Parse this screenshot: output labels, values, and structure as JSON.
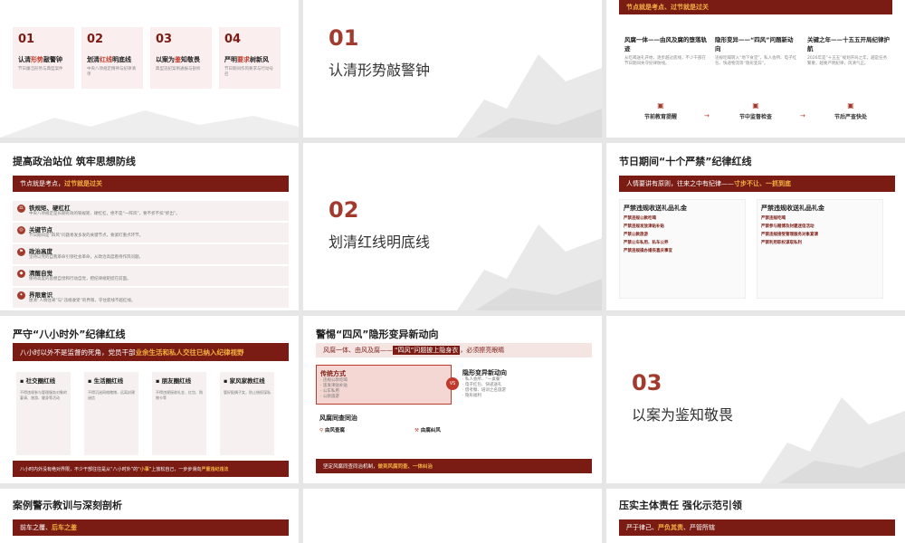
{
  "s1": {
    "banner": "",
    "cards": [
      {
        "num": "01",
        "title_a": "认清",
        "title_b": "形势",
        "title_c": "敲警钟",
        "sub": "节日廉洁形势与典型案件"
      },
      {
        "num": "02",
        "title_a": "划清",
        "title_b": "红线",
        "title_c": "明底线",
        "sub": "中央八项规定精神与纪律清单"
      },
      {
        "num": "03",
        "title_a": "以案为",
        "title_b": "鉴",
        "title_c": "知敬畏",
        "sub": "典型违纪案例通报与剖析"
      },
      {
        "num": "04",
        "title_a": "严明",
        "title_b": "要求",
        "title_c": "树新风",
        "sub": "节日期间作风要求与行动号召"
      }
    ]
  },
  "s2": {
    "num": "01",
    "title": "认清形势敲警钟"
  },
  "s3": {
    "banner": "节点就是考点、过节就是过关",
    "cols": [
      {
        "title": "风腐一体——由风及腐的堕落轨迹",
        "desc": "从吃喝送礼开始，逐步越过底线，不少干部在节日期间失守纪律防线。"
      },
      {
        "title": "隐形变异——“四风”问题新动向",
        "desc": "违规吃喝转入“地下食堂”，私人会所、电子红包、快递物流等“隐形变异”。"
      },
      {
        "title": "关键之年——十五五开局纪律护航",
        "desc": "2026年是“十五五”规划开局之年，越是任务繁重，越要严明纪律，风清气正。"
      }
    ],
    "steps": [
      "节前教育提醒",
      "节中监督检查",
      "节后严查快处"
    ]
  },
  "s4": {
    "title": "提高政治站位 筑牢思想防线",
    "banner_a": "节点就是考点，",
    "banner_b": "过节就是过关",
    "items": [
      {
        "t": "铁规矩、硬杠杠",
        "d": "中央八项规定是长期有效的铁规矩、硬杠杠，绝不是“一阵风”，要不折不扣“抓出”。"
      },
      {
        "t": "关键节点",
        "d": "节日期间是“四风”问题易发多发的关键节点，要紧盯重点环节。"
      },
      {
        "t": "政治高度",
        "d": "坚持以党的自我革命引领社会革命，从政治高度看待作风问题。"
      },
      {
        "t": "清醒自觉",
        "d": "保持高度的思想自觉和行动自觉，把纪律规矩挺在前面。"
      },
      {
        "t": "界限意识",
        "d": "厘清“人情往来”与“违规收受”的界限，守住底线不越红线。"
      }
    ]
  },
  "s5": {
    "num": "02",
    "title": "划清红线明底线"
  },
  "s6": {
    "title": "节日期间“十个严禁”纪律红线",
    "banner_a": "人情要讲有原则，往来之中有纪律——",
    "banner_b": "寸步不让、一抓到底",
    "left_h": "严禁违规收送礼品礼金",
    "left_items": [
      "严禁违规公款吃喝",
      "严禁违规发放津贴补贴",
      "严禁公款旅游",
      "严禁公车私用、私车公养",
      "严禁违规操办婚丧喜庆事宜"
    ],
    "right_h": "严禁违规收送礼品礼金",
    "right_items": [
      "严禁违规吃喝",
      "严禁参与赌博及封建迷信活动",
      "严禁违规接受管理服务对象宴请",
      "严禁利用职权谋取私利"
    ]
  },
  "s7": {
    "title": "严守“八小时外”纪律红线",
    "banner_a": "八小时以外不是监督的死角，党员干部",
    "banner_b": "业余生活和私人交往已纳入纪律视野",
    "cards": [
      {
        "t": "社交圈红线",
        "d": "不得违规参与管理服务对象的宴请、旅游、健身等活动"
      },
      {
        "t": "生活圈红线",
        "d": "不得沉迷网络赌博，远离封建迷信"
      },
      {
        "t": "朋友圈红线",
        "d": "不得违规接收礼金、红包、购物卡等"
      },
      {
        "t": "家风家教红线",
        "d": "管好配偶子女，防止借权谋私"
      }
    ],
    "footer_a": "八小时内外没有绝对界限，不少干部往往是从“八小时外”的“",
    "footer_b": "小事",
    "footer_c": "”上放松自己，一步步滑向",
    "footer_d": "严重违纪违法"
  },
  "s8": {
    "title": "警惕“四风”隐形变异新动向",
    "banner_a": "风腐一体、由风及腐——",
    "banner_b": "“四风”问题披上隐身衣",
    "banner_c": "，必须擦亮眼睛",
    "trad_h": "传统方式",
    "trad_items": [
      "· 违规公款吃喝",
      "· 滥发津贴补贴",
      "· 公车私用",
      "· 公款旅游"
    ],
    "new_h": "隐形变异新动向",
    "new_items": [
      "· 私人会所、“一桌餐”",
      "· 电子红包、快递送礼",
      "· 借考察、培训之名旅游",
      "· 隐形福利"
    ],
    "vs": "VS",
    "same_h": "风腐同查同治",
    "same_a": "由风查腐",
    "same_b": "由腐纠风",
    "footer_a": "坚定风腐同查同治机制，",
    "footer_b": "做到风腐同查、一体纠治"
  },
  "s9": {
    "num": "03",
    "title": "以案为鉴知敬畏"
  },
  "s10": {
    "title": "案例警示教训与深刻剖析",
    "banner_a": "前车之覆、",
    "banner_b": "后车之鉴"
  },
  "s11": {
    "title": "",
    "banner": ""
  },
  "s12": {
    "title": "压实主体责任 强化示范引领",
    "banner_a": "严于律己、",
    "banner_b": "严负其责",
    "banner_c": "、严管所辖"
  }
}
